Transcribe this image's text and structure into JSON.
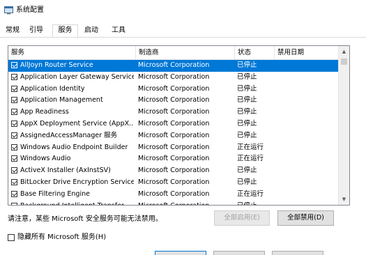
{
  "window": {
    "title": "系统配置"
  },
  "tabs": [
    {
      "label": "常规",
      "active": false
    },
    {
      "label": "引导",
      "active": false
    },
    {
      "label": "服务",
      "active": true
    },
    {
      "label": "启动",
      "active": false
    },
    {
      "label": "工具",
      "active": false
    }
  ],
  "table": {
    "headers": [
      "服务",
      "制造商",
      "状态",
      "禁用日期"
    ],
    "rows": [
      {
        "name": "AllJoyn Router Service",
        "manufacturer": "Microsoft Corporation",
        "status": "已停止",
        "disabled_date": "",
        "checked": true,
        "selected": true
      },
      {
        "name": "Application Layer Gateway Service",
        "manufacturer": "Microsoft Corporation",
        "status": "已停止",
        "disabled_date": "",
        "checked": true,
        "selected": false
      },
      {
        "name": "Application Identity",
        "manufacturer": "Microsoft Corporation",
        "status": "已停止",
        "disabled_date": "",
        "checked": true,
        "selected": false
      },
      {
        "name": "Application Management",
        "manufacturer": "Microsoft Corporation",
        "status": "已停止",
        "disabled_date": "",
        "checked": true,
        "selected": false
      },
      {
        "name": "App Readiness",
        "manufacturer": "Microsoft Corporation",
        "status": "已停止",
        "disabled_date": "",
        "checked": true,
        "selected": false
      },
      {
        "name": "AppX Deployment Service (AppX...",
        "manufacturer": "Microsoft Corporation",
        "status": "已停止",
        "disabled_date": "",
        "checked": true,
        "selected": false
      },
      {
        "name": "AssignedAccessManager 服务",
        "manufacturer": "Microsoft Corporation",
        "status": "已停止",
        "disabled_date": "",
        "checked": true,
        "selected": false
      },
      {
        "name": "Windows Audio Endpoint Builder",
        "manufacturer": "Microsoft Corporation",
        "status": "正在运行",
        "disabled_date": "",
        "checked": true,
        "selected": false
      },
      {
        "name": "Windows Audio",
        "manufacturer": "Microsoft Corporation",
        "status": "正在运行",
        "disabled_date": "",
        "checked": true,
        "selected": false
      },
      {
        "name": "ActiveX Installer (AxInstSV)",
        "manufacturer": "Microsoft Corporation",
        "status": "已停止",
        "disabled_date": "",
        "checked": true,
        "selected": false
      },
      {
        "name": "BitLocker Drive Encryption Service",
        "manufacturer": "Microsoft Corporation",
        "status": "已停止",
        "disabled_date": "",
        "checked": true,
        "selected": false
      },
      {
        "name": "Base Filtering Engine",
        "manufacturer": "Microsoft Corporation",
        "status": "正在运行",
        "disabled_date": "",
        "checked": true,
        "selected": false
      },
      {
        "name": "Background Intelligent Transfer...",
        "manufacturer": "Microsoft Corporation",
        "status": "已停止",
        "disabled_date": "",
        "checked": true,
        "selected": false
      }
    ]
  },
  "note": "请注意，某些 Microsoft 安全服务可能无法禁用。",
  "buttons": {
    "enable_all": "全部启用(E)",
    "disable_all": "全部禁用(D)"
  },
  "hide_microsoft": {
    "label": "隐藏所有 Microsoft 服务(H)",
    "checked": false
  },
  "colors": {
    "selection": "#0078d7",
    "button_face": "#e1e1e1"
  }
}
